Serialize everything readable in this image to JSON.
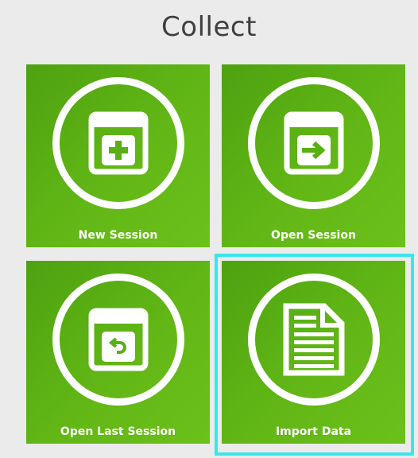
{
  "header": {
    "title": "Collect"
  },
  "tiles": [
    {
      "label": "New Session",
      "icon": "new-session-icon"
    },
    {
      "label": "Open Session",
      "icon": "open-session-icon"
    },
    {
      "label": "Open Last Session",
      "icon": "open-last-session-icon"
    },
    {
      "label": "Import Data",
      "icon": "import-data-icon"
    }
  ],
  "colors": {
    "background": "#ebebeb",
    "tile_green": "#5fb414",
    "focus_ring": "#3ae6ea",
    "title_text": "#404040"
  }
}
